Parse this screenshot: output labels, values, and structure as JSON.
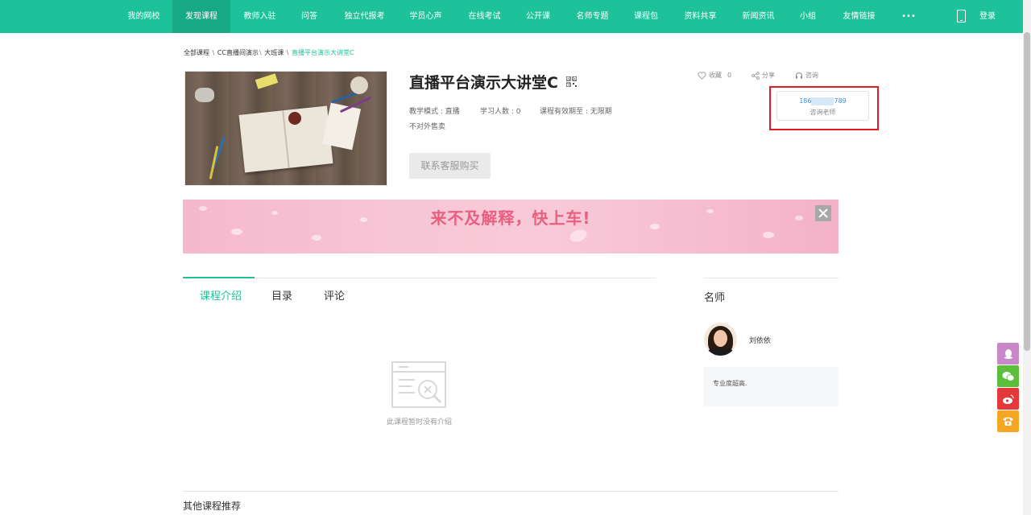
{
  "nav": {
    "items": [
      {
        "label": "我的网校"
      },
      {
        "label": "发现课程"
      },
      {
        "label": "教师入驻"
      },
      {
        "label": "问答"
      },
      {
        "label": "独立代报考"
      },
      {
        "label": "学员心声"
      },
      {
        "label": "在线考试"
      },
      {
        "label": "公开课"
      },
      {
        "label": "名师专题"
      },
      {
        "label": "课程包"
      },
      {
        "label": "资料共享"
      },
      {
        "label": "新闻资讯"
      },
      {
        "label": "小组"
      },
      {
        "label": "友情链接"
      },
      {
        "label": "•••"
      }
    ],
    "active_index": 1,
    "login_label": "登录"
  },
  "breadcrumb": {
    "items": [
      "全部课程",
      "CC直播间演示",
      "大班课"
    ],
    "current": "直播平台演示大讲堂C"
  },
  "course": {
    "title": "直播平台演示大讲堂C",
    "mode_label": "教学模式 : 直播",
    "students_label": "学习人数 : 0",
    "validity_label": "课程有效期至 : 无限期",
    "sale_status": "不对外售卖",
    "buy_button": "联系客服购买"
  },
  "actions": {
    "favorite_label": "收藏",
    "favorite_count": "0",
    "share_label": "分享",
    "consult_label": "咨询"
  },
  "consult_card": {
    "phone_prefix": "186",
    "phone_suffix": "789",
    "label": "咨询老师"
  },
  "banner": {
    "text": "来不及解释，快上车!"
  },
  "tabs": [
    {
      "label": "课程介绍"
    },
    {
      "label": "目录"
    },
    {
      "label": "评论"
    }
  ],
  "empty": {
    "text": "此课程暂时没有介绍"
  },
  "sidebar": {
    "title": "名师",
    "teacher_name": "刘依依",
    "teacher_bio": "专业度超高."
  },
  "other": {
    "title": "其他课程推荐"
  },
  "colors": {
    "brand": "#1dc29a",
    "brand_dark": "#17a886",
    "highlight": "#e01b24",
    "float_qq": "#c888c8",
    "float_wechat": "#5bbf3b",
    "float_weibo": "#e5383b",
    "float_phone": "#f5a623"
  }
}
